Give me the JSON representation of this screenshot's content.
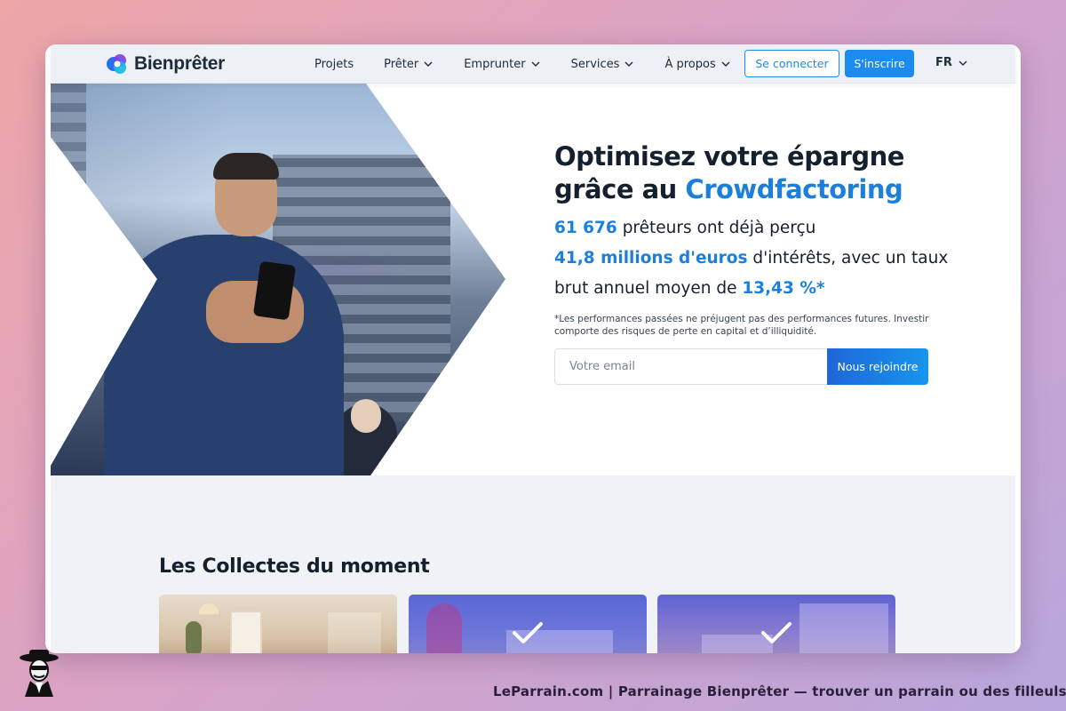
{
  "nav": {
    "brand": "Bienprêter",
    "links": [
      {
        "label": "Projets",
        "dropdown": false
      },
      {
        "label": "Prêter",
        "dropdown": true
      },
      {
        "label": "Emprunter",
        "dropdown": true
      },
      {
        "label": "Services",
        "dropdown": true
      },
      {
        "label": "À propos",
        "dropdown": true
      }
    ],
    "login_label": "Se connecter",
    "signup_label": "S'inscrire",
    "language": "FR"
  },
  "hero": {
    "title_line1": "Optimisez votre épargne",
    "title_line2_prefix": "grâce au ",
    "title_accent": "Crowdfactoring",
    "lenders_count": "61 676",
    "lenders_text": " prêteurs ont déjà perçu",
    "interest_amount": "41,8 millions d'euros",
    "interest_text": " d'intérêts, avec un taux brut annuel moyen de ",
    "rate": "13,43 %*",
    "disclaimer": "*Les performances passées ne préjugent pas des performances futures. Investir comporte des risques de perte en capital et d’illiquidité.",
    "email_placeholder": "Votre email",
    "join_label": "Nous rejoindre"
  },
  "collectes": {
    "title": "Les Collectes du moment"
  },
  "credit": "LeParrain.com | Parrainage Bienprêter — trouver un parrain ou des filleuls",
  "colors": {
    "accent": "#1b7fdb",
    "button": "#1b8bf0",
    "text": "#15202e"
  }
}
